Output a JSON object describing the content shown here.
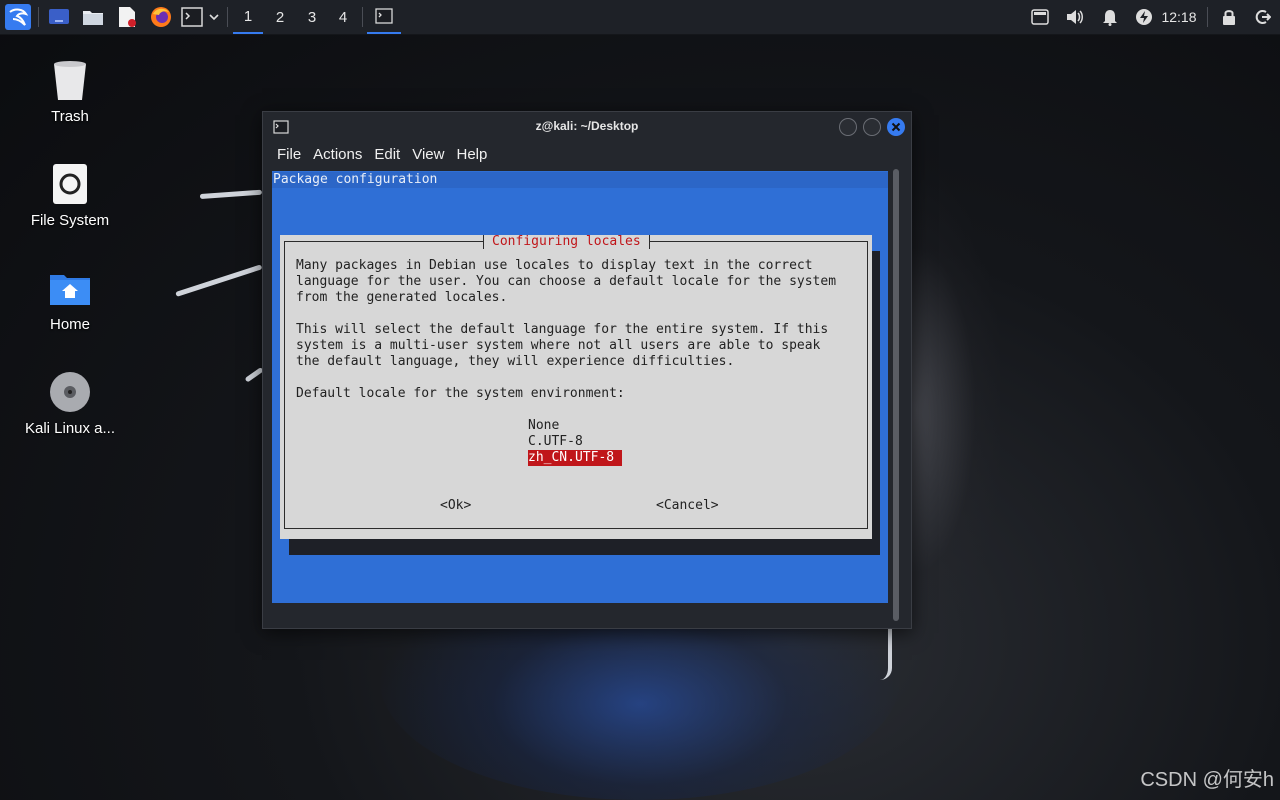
{
  "panel": {
    "workspaces": [
      "1",
      "2",
      "3",
      "4"
    ],
    "active_workspace": "1",
    "clock": "12:18"
  },
  "desktop": {
    "icons": [
      {
        "label": "Trash"
      },
      {
        "label": "File System"
      },
      {
        "label": "Home"
      },
      {
        "label": "Kali Linux a..."
      }
    ]
  },
  "window": {
    "title": "z@kali: ~/Desktop",
    "menu": [
      "File",
      "Actions",
      "Edit",
      "View",
      "Help"
    ]
  },
  "dialog": {
    "header": "Package configuration",
    "title": "Configuring locales",
    "lines": [
      "Many packages in Debian use locales to display text in the correct",
      "language for the user. You can choose a default locale for the system",
      "from the generated locales.",
      "",
      "This will select the default language for the entire system. If this",
      "system is a multi-user system where not all users are able to speak",
      "the default language, they will experience difficulties.",
      "",
      "Default locale for the system environment:"
    ],
    "options": [
      "None",
      "C.UTF-8",
      "zh_CN.UTF-8"
    ],
    "selected_option": "zh_CN.UTF-8",
    "ok_label": "<Ok>",
    "cancel_label": "<Cancel>"
  },
  "watermark": "CSDN @何安h",
  "colors": {
    "accent": "#367bf0",
    "dialog_bg": "#d7d7d7",
    "terminal_bg": "#2f6fd6",
    "selection": "#c0161a"
  }
}
